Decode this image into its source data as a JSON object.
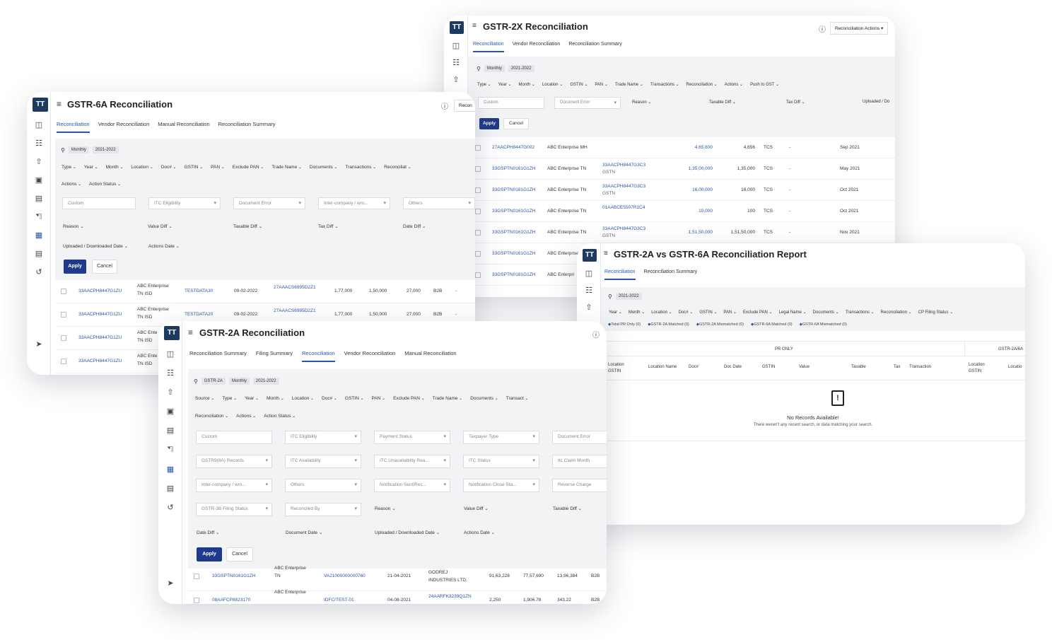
{
  "win2x": {
    "title": "GSTR-2X Reconciliation",
    "actions_label": "Reconciliation Actions",
    "tabs": [
      "Reconciliation",
      "Vendor Reconciliation",
      "Reconciliation Summary"
    ],
    "chips": [
      "Monthly",
      "2021-2022"
    ],
    "filters": [
      "Type",
      "Year",
      "Month",
      "Location",
      "GSTIN",
      "PAN",
      "Trade Name",
      "Transactions",
      "Reconciliation",
      "Actions",
      "Push to GST"
    ],
    "custom_placeholder": "Custom",
    "doc_error": "Document Error",
    "reason": "Reason",
    "taxable_diff": "Taxable Diff",
    "tax_diff": "Tax Diff",
    "uploaded": "Uploaded / Do",
    "apply": "Apply",
    "cancel": "Cancel",
    "rows": [
      {
        "gstin": "27AACPH8447G002",
        "name": "ABC Enterprise MH",
        "pan": "",
        "pan2": "",
        "value": "4,65,600",
        "tax": "4,656",
        "type": "TCS",
        "dash": "-",
        "month": "Sep 2021"
      },
      {
        "gstin": "33GSPTN0161G1ZH",
        "name": "ABC Enterprise TN",
        "pan": "33AACPH8447G3C3",
        "pan2": "GSTN",
        "value": "1,35,00,000",
        "tax": "1,35,000",
        "type": "TCS",
        "dash": "-",
        "month": "May 2021"
      },
      {
        "gstin": "33GSPTN0161G1ZH",
        "name": "ABC Enterprise TN",
        "pan": "33AACPH8447G3C3",
        "pan2": "GSTN",
        "value": "16,00,000",
        "tax": "16,000",
        "type": "TCS",
        "dash": "-",
        "month": "Oct 2021"
      },
      {
        "gstin": "33GSPTN0161G1ZH",
        "name": "ABC Enterprise TN",
        "pan": "01AABCE5507R1C4",
        "pan2": "",
        "value": "10,000",
        "tax": "100",
        "type": "TCS",
        "dash": "-",
        "month": "Oct 2021"
      },
      {
        "gstin": "33GSPTN0161G1ZH",
        "name": "ABC Enterprise TN",
        "pan": "33AACPH8447G3C3",
        "pan2": "GSTN",
        "value": "1,51,50,000",
        "tax": "1,51,50,000",
        "type": "TCS",
        "dash": "-",
        "month": "Nov 2021"
      },
      {
        "gstin": "33GSPTN0161G1ZH",
        "name": "ABC Enterprise TN",
        "pan": "",
        "pan2": "",
        "value": "",
        "tax": "",
        "type": "",
        "dash": "",
        "month": ""
      },
      {
        "gstin": "33GSPTN0161G1ZH",
        "name": "ABC Enterpri",
        "pan": "",
        "pan2": "",
        "value": "",
        "tax": "",
        "type": "",
        "dash": "",
        "month": ""
      }
    ]
  },
  "win6a": {
    "title": "GSTR-6A Reconciliation",
    "recon_btn": "Recon",
    "tabs": [
      "Reconciliation",
      "Vendor Reconciliation",
      "Manual Reconciliation",
      "Reconciliation Summary"
    ],
    "chips": [
      "Monthly",
      "2021-2022"
    ],
    "filters1": [
      "Type",
      "Year",
      "Month",
      "Location",
      "Doc#",
      "GSTIN",
      "PAN",
      "Exclude PAN",
      "Trade Name",
      "Documents",
      "Transactions",
      "Reconciliat"
    ],
    "filters2": [
      "Actions",
      "Action Status"
    ],
    "inputs": [
      "Custom",
      "ITC Eligibility",
      "Document Error",
      "Inter-company / wro...",
      "Others"
    ],
    "labels": [
      "Reason",
      "Value Diff",
      "Taxable Diff",
      "Tax Diff",
      "Date Diff"
    ],
    "labels2": [
      "Uploaded / Downloaded Date",
      "Actions Date"
    ],
    "apply": "Apply",
    "cancel": "Cancel",
    "rows": [
      {
        "gstin": "33AACPH8447G1ZU",
        "name1": "ABC Enterprise",
        "name2": "TN ISD",
        "doc": "TESTDATA30",
        "date": "09-02-2022",
        "cp": "27AAACS6995D2Z1",
        "v1": "1,77,000",
        "v2": "1,50,000",
        "v3": "27,000",
        "t": "B2B",
        "d": "-"
      },
      {
        "gstin": "33AACPH8447G1ZU",
        "name1": "ABC Enterprise",
        "name2": "TN ISD",
        "doc": "TESTDATA20",
        "date": "09-02-2022",
        "cp": "27AAACS6995D2Z1",
        "v1": "1,77,000",
        "v2": "1,50,000",
        "v3": "27,000",
        "t": "B2B",
        "d": "-"
      },
      {
        "gstin": "33AACPH8447G1ZU",
        "name1": "ABC Ente",
        "name2": "TN ISD",
        "doc": "",
        "date": "",
        "cp": "",
        "v1": "",
        "v2": "",
        "v3": "",
        "t": "",
        "d": ""
      },
      {
        "gstin": "33AACPH8447G1ZU",
        "name1": "ABC Ente",
        "name2": "TN ISD",
        "doc": "",
        "date": "",
        "cp": "",
        "v1": "",
        "v2": "",
        "v3": "",
        "t": "",
        "d": ""
      }
    ]
  },
  "win2a6a": {
    "title": "GSTR-2A vs GSTR-6A Reconciliation Report",
    "tabs": [
      "Reconciliation",
      "Reconciliation Summary"
    ],
    "chip": "2021-2022",
    "filters": [
      "Year",
      "Month",
      "Location",
      "Doc#",
      "GSTIN",
      "PAN",
      "Exclude PAN",
      "Legal Name",
      "Documents",
      "Transactions",
      "Reconciliation",
      "CP Filing Status"
    ],
    "legend": [
      "Total PR Only (0)",
      "GSTR-2A Matched (0)",
      "GSTR-2A Mismatched (0)",
      "GSTR-6A Matched (0)",
      "GSTR-6A Mismatched (0)"
    ],
    "group_pr": "PR ONLY",
    "group_2a": "GSTR-2A/6A",
    "headers": [
      "Location GSTIN",
      "Location Name",
      "Doc#",
      "Doc Date",
      "GSTIN",
      "Value",
      "Taxable",
      "Tax",
      "Transaction",
      "Location GSTIN",
      "Locatio"
    ],
    "empty_title": "No Records Available!",
    "empty_sub": "There weren't any recent search, or data matching your search."
  },
  "win2a": {
    "title": "GSTR-2A Reconciliation",
    "tabs": [
      "Reconciliation Summary",
      "Filing Summary",
      "Reconciliation",
      "Vendor Reconciliation",
      "Manual Reconciliation"
    ],
    "chips": [
      "GSTR-2A",
      "Monthly",
      "2021-2022"
    ],
    "filters1": [
      "Source",
      "Type",
      "Year",
      "Month",
      "Location",
      "Doc#",
      "GSTIN",
      "PAN",
      "Exclude PAN",
      "Trade Name",
      "Documents",
      "Transact"
    ],
    "filters2": [
      "Reconciliation",
      "Actions",
      "Action Status"
    ],
    "inputs_r1": [
      "Custom",
      "ITC Eligibility",
      "Payment Status",
      "Taxpayer Type",
      "Document Error"
    ],
    "inputs_r2": [
      "GSTR9(8A) Records",
      "ITC Availability",
      "ITC Unavailability Rea...",
      "ITC Status",
      "Itc Claim Month"
    ],
    "inputs_r3": [
      "Inter-company / wro...",
      "Others",
      "Notification Sent/Rec...",
      "Notification Close Sta...",
      "Reverse Charge"
    ],
    "inputs_r4": [
      "GSTR-3B Filing Status",
      "Reconciled By"
    ],
    "labels_r4": [
      "Reason",
      "Value Diff",
      "Taxable Diff"
    ],
    "labels_r5": [
      "Date Diff",
      "Document Date",
      "Uploaded / Downloaded Date",
      "Actions Date"
    ],
    "apply": "Apply",
    "cancel": "Cancel",
    "rows": [
      {
        "gstin": "33GSPTN0161G1ZH",
        "name1": "ABC Enterprise",
        "name2": "TN",
        "doc": "VA21000000000760",
        "date": "21-04-2021",
        "cp1": "GODREJ",
        "cp2": "INDUSTRIES LTD.",
        "v1": "91,63,228",
        "v2": "77,57,690",
        "v3": "13,96,384",
        "t": "B2B"
      },
      {
        "gstin": "08AAFCP8823170",
        "name1": "ABC Enterprise",
        "name2": "",
        "doc": "IDFC/TEST-01",
        "date": "04-08-2021",
        "cp1": "24AARFK3239Q1ZN",
        "cp2": "",
        "v1": "2,250",
        "v2": "1,906.78",
        "v3": "343.22",
        "t": "B2B"
      }
    ]
  }
}
